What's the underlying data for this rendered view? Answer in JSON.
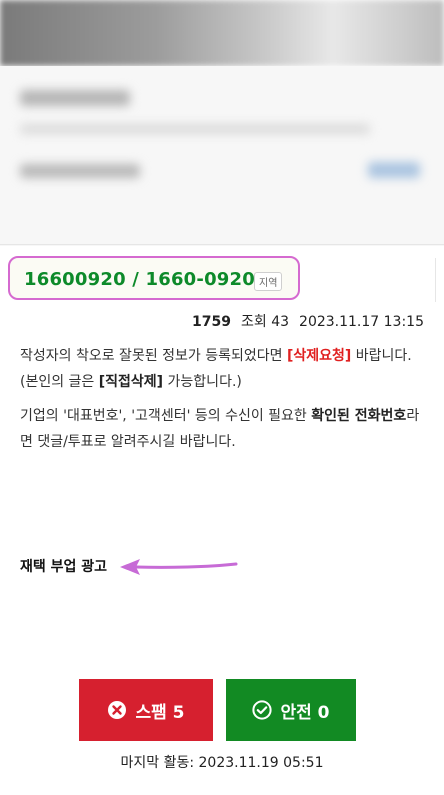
{
  "listing": {
    "phone": "16600920  /  1660-0920",
    "region_tag": "지역"
  },
  "meta": {
    "count": "1759",
    "views": "조회 43",
    "datetime": "2023.11.17 13:15"
  },
  "notice1": {
    "part1": "작성자의 착오로 잘못된 정보가 등록되었다면 ",
    "link": "[삭제요청]",
    "part2": " 바랍니다. (본인의 글은 ",
    "bold": "[직접삭제]",
    "part3": " 가능합니다.)"
  },
  "notice2": {
    "part1": "기업의 '대표번호', '고객센터' 등의 수신이 필요한 ",
    "bold": "확인된 전화번호",
    "part2": "라면 댓글/투표로 알려주시길 바랍니다."
  },
  "ad_label": "재택 부업 광고",
  "buttons": {
    "spam_label": "스팸 5",
    "safe_label": "안전 0"
  },
  "last_activity": "마지막 활동: 2023.11.19 05:51",
  "colors": {
    "phone_green": "#0d8a2a",
    "highlight_border": "#d56ad0",
    "spam_red": "#d6202f",
    "safe_green": "#128a23",
    "link_red": "#e02020"
  }
}
